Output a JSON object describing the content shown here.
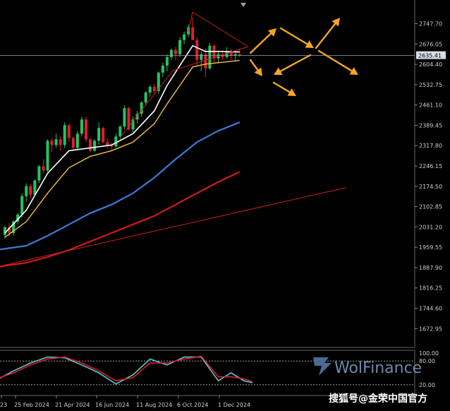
{
  "chart_data": [
    {
      "type": "line",
      "subtype": "candlestick",
      "background": "#000000",
      "y_ticks": [
        "2747.70",
        "2676.05",
        "2604.40",
        "2532.75",
        "2461.10",
        "2389.45",
        "2317.80",
        "2246.15",
        "2174.50",
        "2102.85",
        "2031.20",
        "1959.55",
        "1887.90",
        "1816.25",
        "1744.60",
        "1672.95"
      ],
      "ylim": [
        1640,
        2790
      ],
      "last_price_label": "2635.41",
      "x_ticks": [
        "23",
        "25 Feb 2024",
        "21 Apr 2024",
        "16 Jun 2024",
        "11 Aug 2024",
        "6 Oct 2024",
        "1 Dec 2024"
      ],
      "colors": {
        "bull": "#22c55e",
        "bear": "#e11d2e",
        "ma_fast": "#ffffff",
        "ma_mid": "#f5c04a",
        "ma_slow": "#3a7bd5",
        "ma_long": "#d11a1a",
        "trend": "#cc1f1f",
        "arrows": "#f5a623",
        "grid": "#2a2a2a",
        "price_line": "#9aa4b8"
      },
      "candles": [
        [
          2003,
          2035,
          1990,
          2030
        ],
        [
          2030,
          2045,
          1998,
          2010
        ],
        [
          2010,
          2055,
          2000,
          2050
        ],
        [
          2050,
          2080,
          2040,
          2075
        ],
        [
          2075,
          2150,
          2065,
          2140
        ],
        [
          2140,
          2185,
          2120,
          2175
        ],
        [
          2175,
          2182,
          2130,
          2145
        ],
        [
          2145,
          2200,
          2140,
          2195
        ],
        [
          2195,
          2250,
          2185,
          2245
        ],
        [
          2245,
          2270,
          2220,
          2230
        ],
        [
          2230,
          2340,
          2225,
          2335
        ],
        [
          2335,
          2345,
          2295,
          2320
        ],
        [
          2320,
          2360,
          2310,
          2340
        ],
        [
          2340,
          2350,
          2300,
          2320
        ],
        [
          2320,
          2400,
          2310,
          2390
        ],
        [
          2390,
          2395,
          2330,
          2345
        ],
        [
          2345,
          2350,
          2300,
          2310
        ],
        [
          2310,
          2370,
          2305,
          2360
        ],
        [
          2360,
          2420,
          2350,
          2410
        ],
        [
          2410,
          2420,
          2330,
          2340
        ],
        [
          2340,
          2345,
          2295,
          2300
        ],
        [
          2300,
          2340,
          2295,
          2335
        ],
        [
          2335,
          2400,
          2320,
          2380
        ],
        [
          2380,
          2385,
          2325,
          2330
        ],
        [
          2330,
          2345,
          2310,
          2320
        ],
        [
          2320,
          2330,
          2300,
          2315
        ],
        [
          2315,
          2360,
          2310,
          2350
        ],
        [
          2350,
          2390,
          2340,
          2385
        ],
        [
          2385,
          2460,
          2375,
          2450
        ],
        [
          2450,
          2455,
          2370,
          2375
        ],
        [
          2375,
          2420,
          2365,
          2410
        ],
        [
          2410,
          2440,
          2395,
          2430
        ],
        [
          2430,
          2475,
          2420,
          2470
        ],
        [
          2470,
          2510,
          2460,
          2505
        ],
        [
          2505,
          2530,
          2490,
          2525
        ],
        [
          2525,
          2535,
          2500,
          2510
        ],
        [
          2510,
          2580,
          2500,
          2575
        ],
        [
          2575,
          2610,
          2560,
          2600
        ],
        [
          2600,
          2640,
          2580,
          2630
        ],
        [
          2630,
          2660,
          2620,
          2655
        ],
        [
          2655,
          2665,
          2620,
          2640
        ],
        [
          2640,
          2700,
          2630,
          2690
        ],
        [
          2690,
          2720,
          2675,
          2710
        ],
        [
          2710,
          2745,
          2700,
          2735
        ],
        [
          2735,
          2770,
          2700,
          2690
        ],
        [
          2690,
          2700,
          2600,
          2620
        ],
        [
          2620,
          2650,
          2580,
          2640
        ],
        [
          2640,
          2660,
          2560,
          2590
        ],
        [
          2590,
          2680,
          2585,
          2670
        ],
        [
          2670,
          2675,
          2610,
          2625
        ],
        [
          2625,
          2650,
          2610,
          2640
        ],
        [
          2640,
          2655,
          2620,
          2630
        ],
        [
          2630,
          2665,
          2625,
          2650
        ],
        [
          2650,
          2660,
          2620,
          2635
        ],
        [
          2635,
          2650,
          2615,
          2640
        ],
        [
          2640,
          2660,
          2630,
          2636
        ]
      ],
      "moving_averages": [
        {
          "id": "ma_fast",
          "points": [
            [
              0,
              2010
            ],
            [
              5,
              2090
            ],
            [
              10,
              2220
            ],
            [
              15,
              2300
            ],
            [
              20,
              2310
            ],
            [
              25,
              2320
            ],
            [
              30,
              2360
            ],
            [
              35,
              2440
            ],
            [
              38,
              2530
            ],
            [
              41,
              2600
            ],
            [
              44,
              2670
            ],
            [
              47,
              2650
            ],
            [
              50,
              2650
            ],
            [
              55,
              2648
            ]
          ]
        },
        {
          "id": "ma_mid",
          "points": [
            [
              0,
              1995
            ],
            [
              5,
              2050
            ],
            [
              10,
              2150
            ],
            [
              15,
              2240
            ],
            [
              20,
              2280
            ],
            [
              25,
              2300
            ],
            [
              30,
              2330
            ],
            [
              35,
              2395
            ],
            [
              38,
              2465
            ],
            [
              41,
              2530
            ],
            [
              44,
              2595
            ],
            [
              47,
              2605
            ],
            [
              50,
              2610
            ],
            [
              55,
              2618
            ]
          ]
        },
        {
          "id": "ma_slow",
          "points": [
            [
              -2,
              1950
            ],
            [
              5,
              1965
            ],
            [
              10,
              2000
            ],
            [
              15,
              2040
            ],
            [
              20,
              2080
            ],
            [
              25,
              2110
            ],
            [
              30,
              2150
            ],
            [
              35,
              2205
            ],
            [
              40,
              2270
            ],
            [
              45,
              2330
            ],
            [
              50,
              2370
            ],
            [
              55,
              2400
            ]
          ]
        },
        {
          "id": "ma_long",
          "points": [
            [
              -2,
              1890
            ],
            [
              5,
              1905
            ],
            [
              10,
              1925
            ],
            [
              15,
              1950
            ],
            [
              20,
              1980
            ],
            [
              25,
              2010
            ],
            [
              30,
              2040
            ],
            [
              35,
              2070
            ],
            [
              40,
              2110
            ],
            [
              45,
              2150
            ],
            [
              50,
              2190
            ],
            [
              55,
              2225
            ]
          ]
        },
        {
          "id": "trend",
          "points": [
            [
              -2,
              1890
            ],
            [
              80,
              2170
            ]
          ]
        }
      ],
      "stochastic": {
        "y_ticks": [
          "100.00",
          "80.00",
          "20.00"
        ],
        "k": [
          [
            -2,
            32
          ],
          [
            2,
            55
          ],
          [
            6,
            75
          ],
          [
            10,
            90
          ],
          [
            14,
            88
          ],
          [
            18,
            70
          ],
          [
            22,
            50
          ],
          [
            26,
            22
          ],
          [
            30,
            45
          ],
          [
            34,
            85
          ],
          [
            38,
            70
          ],
          [
            42,
            90
          ],
          [
            46,
            90
          ],
          [
            50,
            30
          ],
          [
            53,
            50
          ],
          [
            56,
            30
          ],
          [
            58,
            25
          ]
        ],
        "d": [
          [
            -2,
            35
          ],
          [
            2,
            50
          ],
          [
            6,
            70
          ],
          [
            10,
            85
          ],
          [
            14,
            90
          ],
          [
            18,
            75
          ],
          [
            22,
            55
          ],
          [
            26,
            30
          ],
          [
            30,
            38
          ],
          [
            34,
            75
          ],
          [
            38,
            75
          ],
          [
            42,
            85
          ],
          [
            46,
            92
          ],
          [
            50,
            40
          ],
          [
            53,
            40
          ],
          [
            56,
            35
          ],
          [
            58,
            28
          ]
        ]
      }
    }
  ],
  "watermark": {
    "logo": "WolFinance",
    "source": "搜狐号@金荣中国官方"
  }
}
